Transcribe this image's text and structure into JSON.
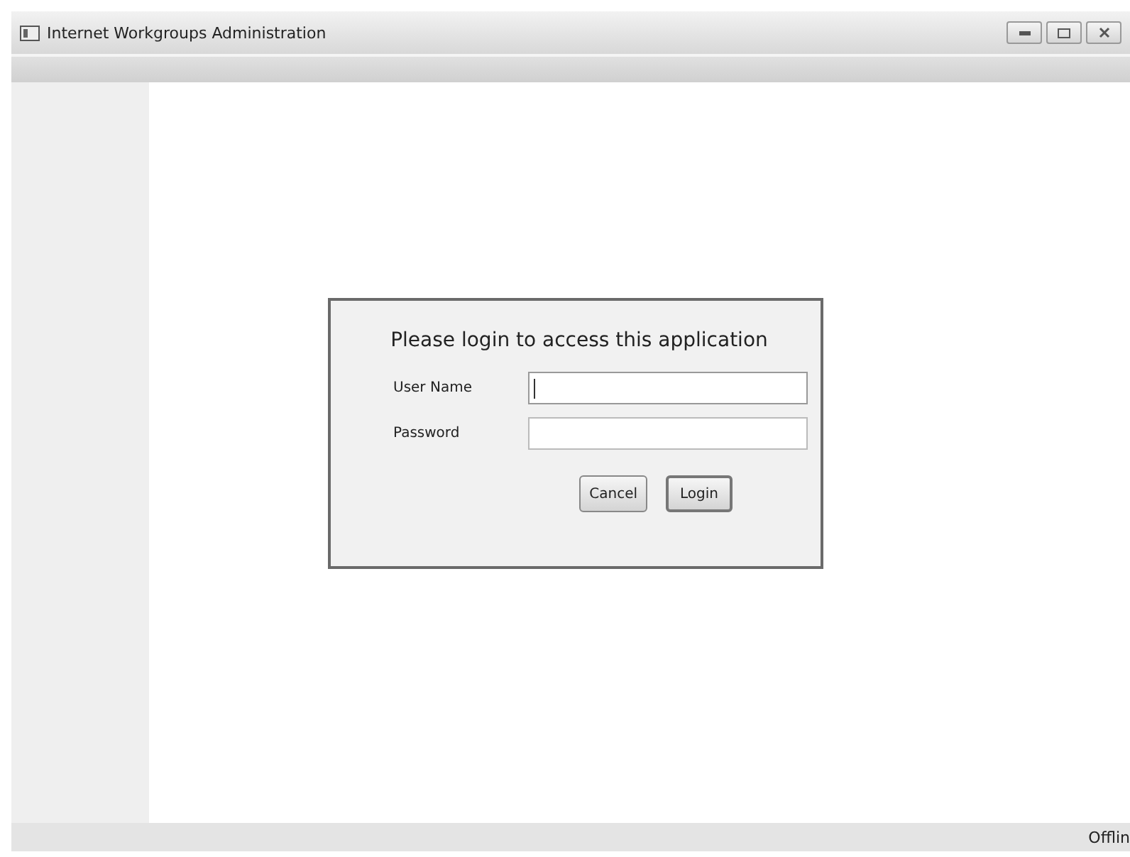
{
  "window": {
    "title": "Internet Workgroups Administration"
  },
  "login_dialog": {
    "heading": "Please login to access this application",
    "fields": [
      {
        "label": "User Name",
        "focused": true
      },
      {
        "label": "Password",
        "focused": false
      }
    ],
    "buttons": [
      {
        "label": "Cancel",
        "kind": "cancel"
      },
      {
        "label": "Login",
        "kind": "default"
      }
    ]
  },
  "status_bar": {
    "status": "Offlin"
  }
}
